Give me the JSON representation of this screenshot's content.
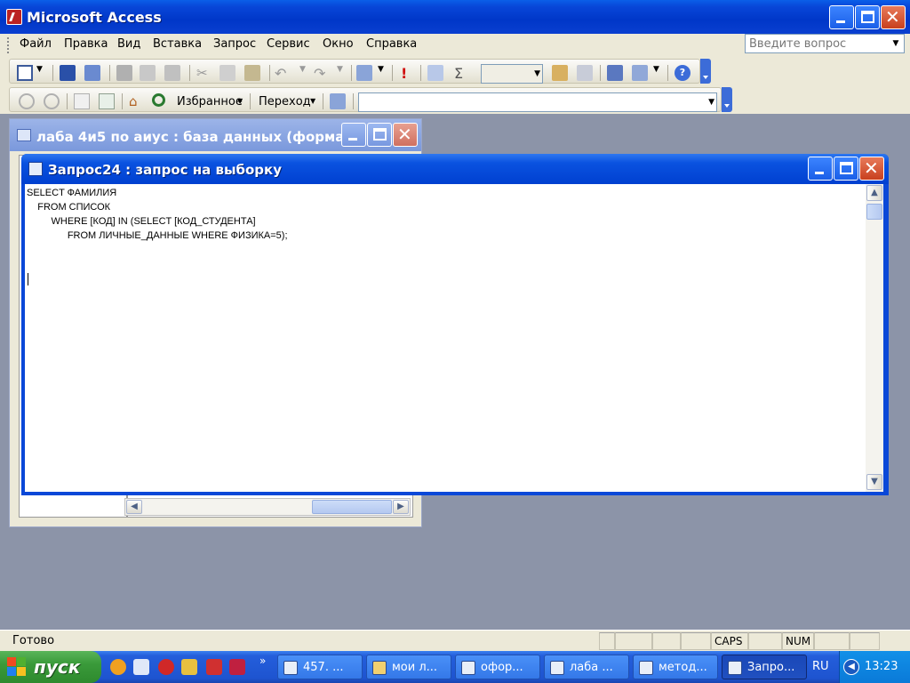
{
  "app": {
    "title": "Microsoft Access"
  },
  "menu": {
    "items": [
      "Файл",
      "Правка",
      "Вид",
      "Вставка",
      "Запрос",
      "Сервис",
      "Окно",
      "Справка"
    ],
    "help_placeholder": "Введите вопрос"
  },
  "web_toolbar": {
    "favorites_label": "Избранное",
    "goto_label": "Переход"
  },
  "db_window": {
    "title": "лаба 4и5 по аиус : база данных (формат..."
  },
  "query_window": {
    "title": "Запрос24 : запрос на выборку",
    "sql": "SELECT ФАМИЛИЯ\n    FROM СПИСОК\n         WHERE [КОД] IN (SELECT [КОД_СТУДЕНТА]\n               FROM ЛИЧНЫЕ_ДАННЫЕ WHERE ФИЗИКА=5);"
  },
  "status": {
    "ready": "Готово",
    "caps": "CAPS",
    "num": "NUM"
  },
  "taskbar": {
    "start_label": "пуск",
    "tasks": [
      "457. ...",
      "мои л...",
      "офор...",
      "лаба ...",
      "метод...",
      "Запро..."
    ],
    "lang": "RU",
    "clock": "13:23"
  },
  "colors": {
    "title_blue": "#0040d0",
    "close_red": "#c8401e",
    "start_green": "#3a9a3a"
  }
}
